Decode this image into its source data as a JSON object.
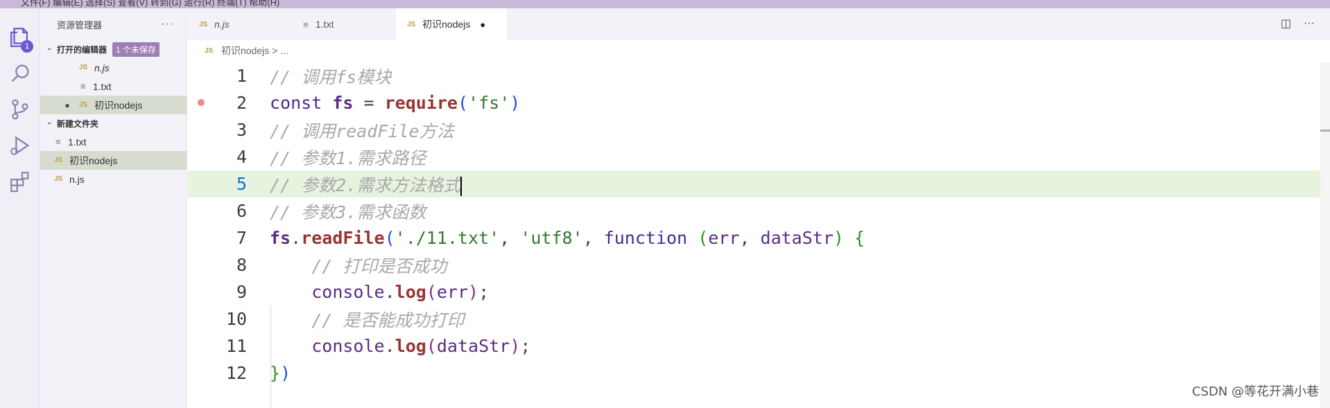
{
  "titlebar": {
    "menu_text": "文件(F)   编辑(E)   选择(S)   查看(V)   转到(G)   运行(R)   终端(T)   帮助(H)"
  },
  "activity_bar": {
    "items": [
      {
        "icon": "files-icon",
        "badge": "1"
      },
      {
        "icon": "search-icon"
      },
      {
        "icon": "source-control-icon"
      },
      {
        "icon": "run-debug-icon"
      },
      {
        "icon": "extensions-icon"
      }
    ]
  },
  "sidebar": {
    "title": "资源管理器",
    "more": "···",
    "open_editors": {
      "label": "打开的编辑器",
      "badge": "1 个未保存",
      "items": [
        {
          "icon": "JS",
          "name": "n.js"
        },
        {
          "icon": "≡",
          "name": "1.txt"
        },
        {
          "icon": "JS",
          "name": "初识nodejs",
          "dot": "●"
        }
      ]
    },
    "folder": {
      "label": "新建文件夹",
      "items": [
        {
          "icon": "≡",
          "name": "1.txt"
        },
        {
          "icon": "JS",
          "name": "初识nodejs"
        },
        {
          "icon": "JS",
          "name": "n.js"
        }
      ]
    }
  },
  "tabs": [
    {
      "icon": "JS",
      "label": "n.js"
    },
    {
      "icon": "≡",
      "label": "1.txt"
    },
    {
      "icon": "JS",
      "label": "初识nodejs",
      "dirty": "●"
    }
  ],
  "breadcrumb": {
    "icon": "JS",
    "file": "初识nodejs",
    "sep": ">",
    "rest": "..."
  },
  "editor": {
    "line_numbers": [
      "1",
      "2",
      "3",
      "4",
      "5",
      "6",
      "7",
      "8",
      "9",
      "10",
      "11",
      "12"
    ],
    "current_line": "5"
  },
  "watermark": "CSDN @等花开满小巷",
  "colors": {
    "accent": "#6a5acd",
    "current_line": "#e6f3df",
    "selected_row": "#d6ddd0",
    "breakpoint": "#e88a8a"
  }
}
